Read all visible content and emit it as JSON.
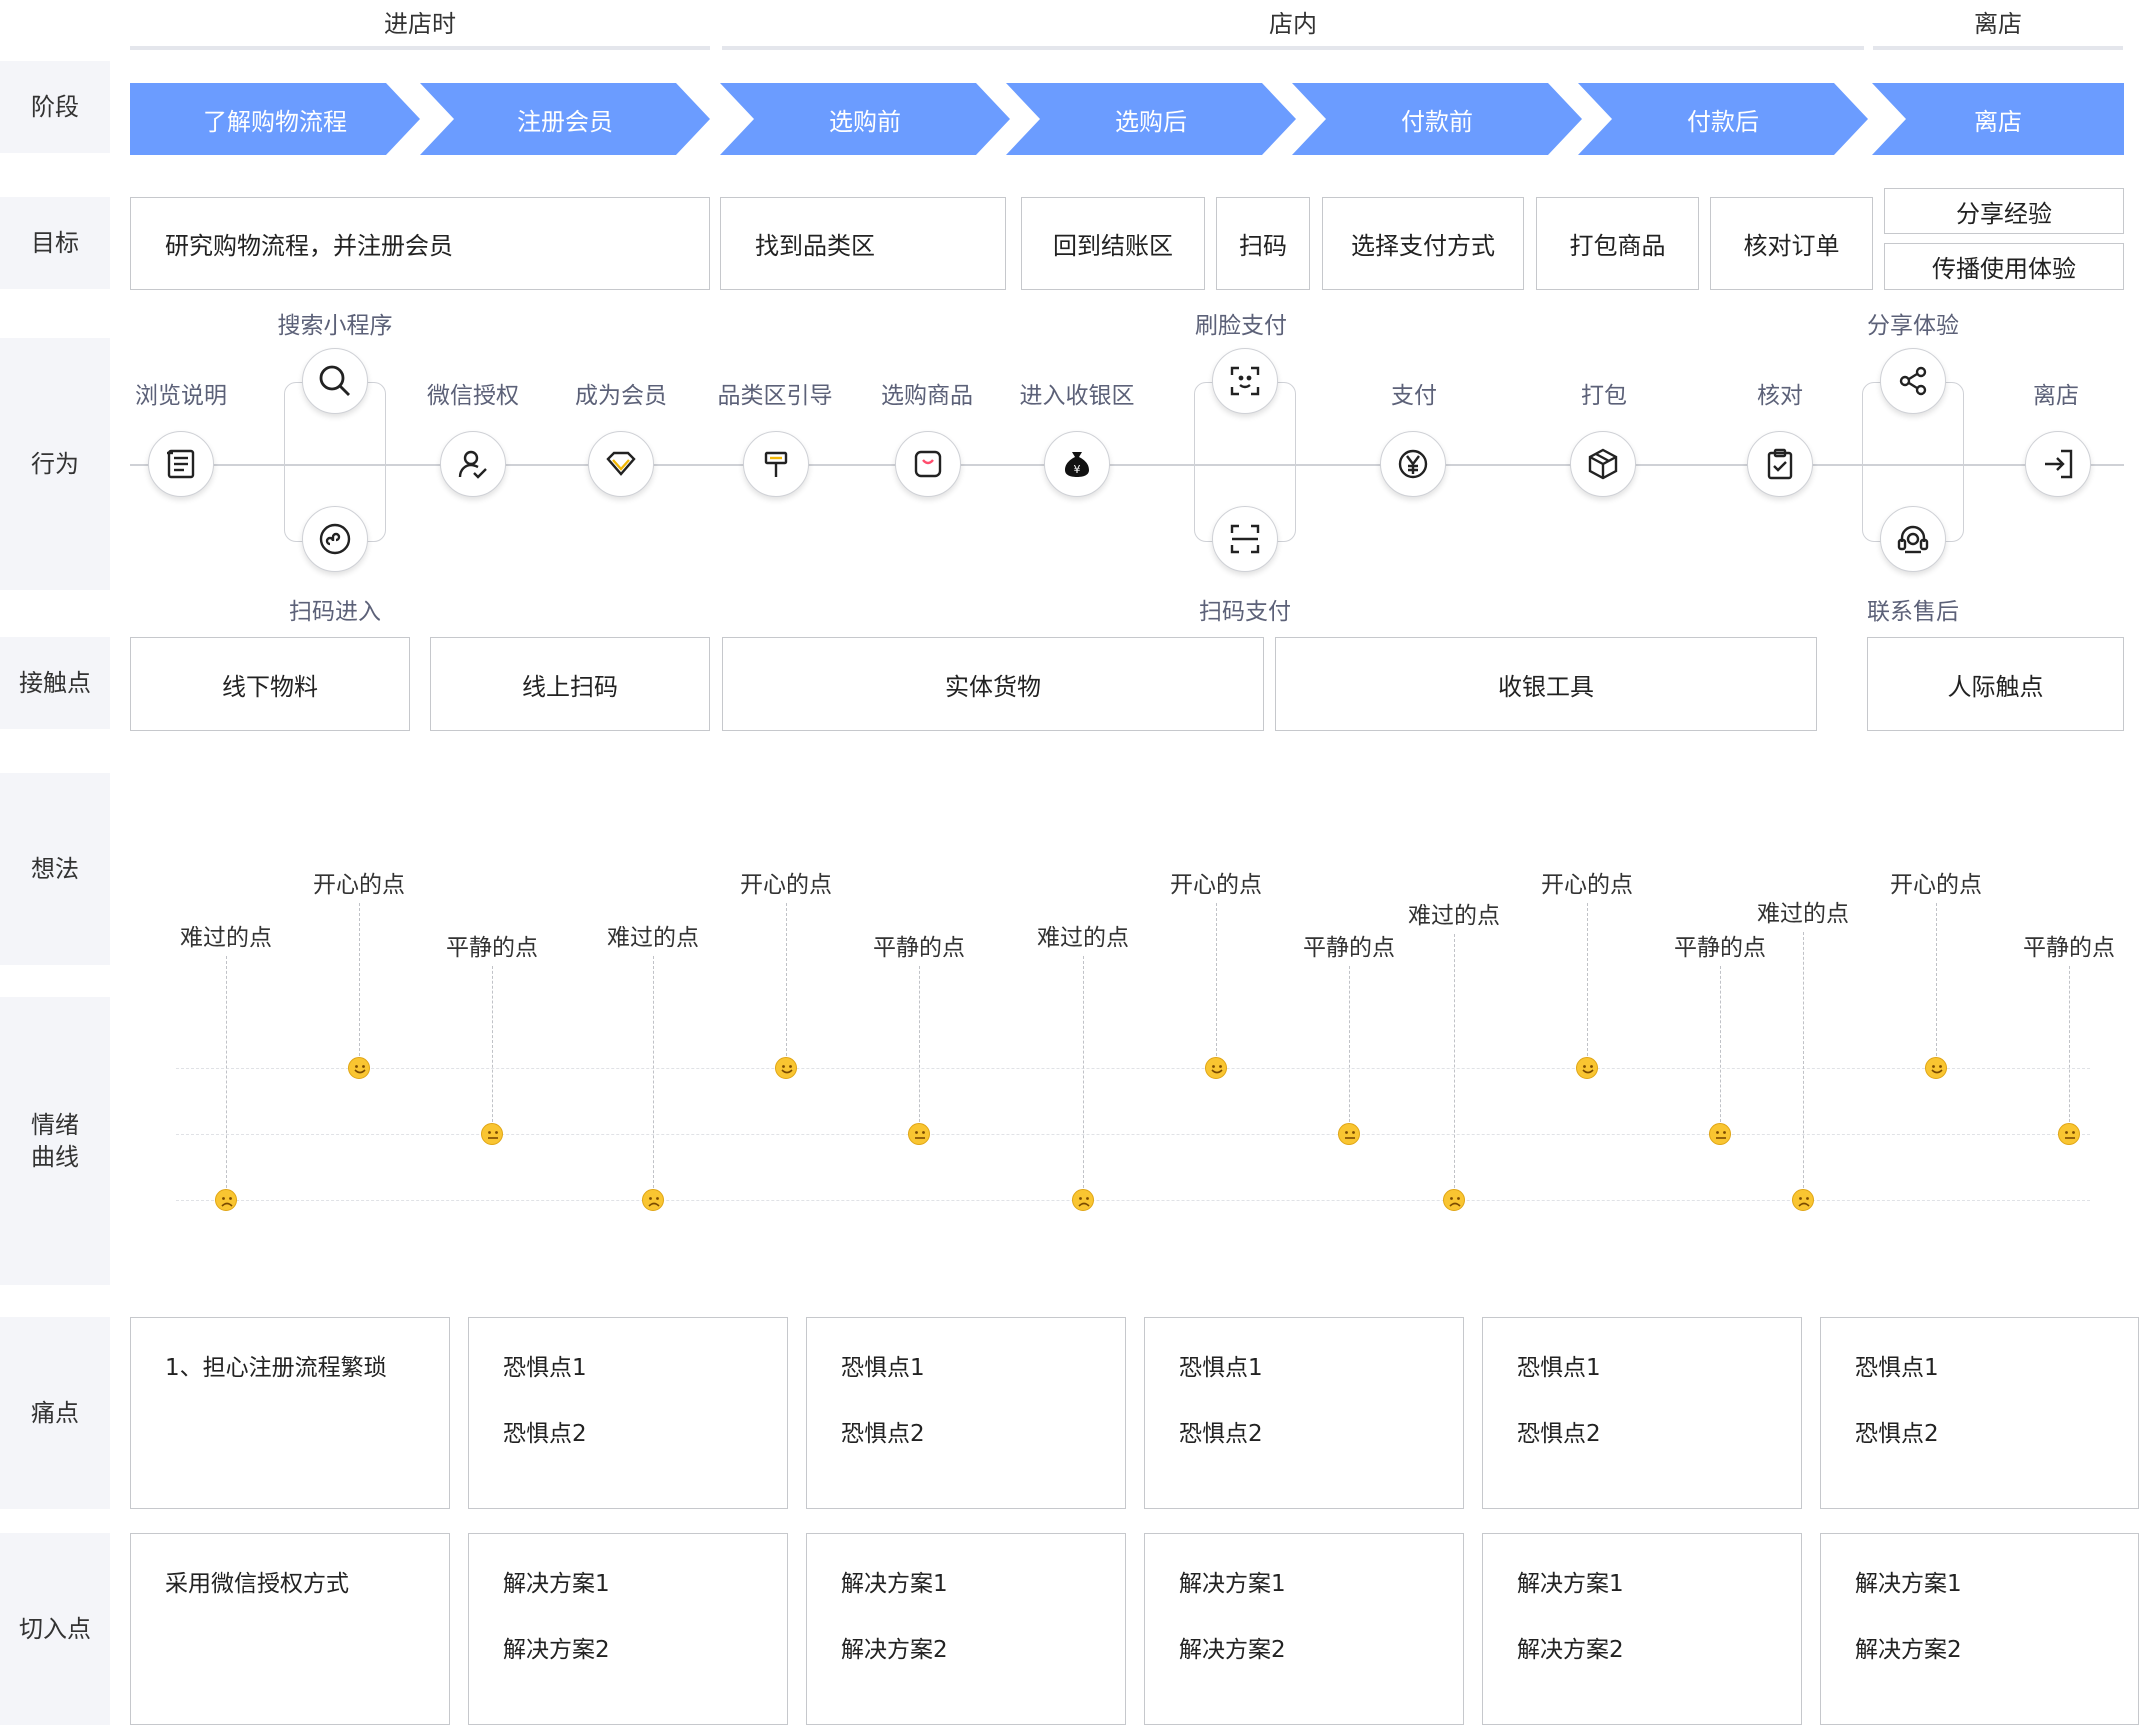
{
  "groups": [
    {
      "label": "进店时"
    },
    {
      "label": "店内"
    },
    {
      "label": "离店"
    }
  ],
  "rows": {
    "stage": "阶段",
    "goal": "目标",
    "behavior": "行为",
    "touchpoint": "接触点",
    "thought": "想法",
    "emotion": "情绪曲线",
    "pain": "痛点",
    "entry": "切入点"
  },
  "stages": [
    "了解购物流程",
    "注册会员",
    "选购前",
    "选购后",
    "付款前",
    "付款后",
    "离店"
  ],
  "goals": [
    "研究购物流程，并注册会员",
    "找到品类区",
    "回到结账区",
    "扫码",
    "选择支付方式",
    "打包商品",
    "核对订单",
    "分享经验",
    "传播使用体验"
  ],
  "actions": {
    "browse": {
      "label": "浏览说明",
      "icon": "document-icon"
    },
    "search_mini": {
      "label": "搜索小程序",
      "icon": "search-icon"
    },
    "scan_enter": {
      "label": "扫码进入",
      "icon": "mini-program-icon"
    },
    "wechat_auth": {
      "label": "微信授权",
      "icon": "user-check-icon"
    },
    "member": {
      "label": "成为会员",
      "icon": "diamond-icon"
    },
    "guide": {
      "label": "品类区引导",
      "icon": "signpost-icon"
    },
    "select": {
      "label": "选购商品",
      "icon": "shopping-bag-icon"
    },
    "checkout_zone": {
      "label": "进入收银区",
      "icon": "money-bag-icon"
    },
    "face_pay": {
      "label": "刷脸支付",
      "icon": "face-scan-icon"
    },
    "scan_pay": {
      "label": "扫码支付",
      "icon": "scan-icon"
    },
    "pay": {
      "label": "支付",
      "icon": "yen-icon"
    },
    "pack": {
      "label": "打包",
      "icon": "box-icon"
    },
    "verify": {
      "label": "核对",
      "icon": "clipboard-check-icon"
    },
    "share": {
      "label": "分享体验",
      "icon": "share-icon"
    },
    "contact": {
      "label": "联系售后",
      "icon": "headset-icon"
    },
    "leave": {
      "label": "离店",
      "icon": "exit-icon"
    }
  },
  "touchpoints": [
    "线下物料",
    "线上扫码",
    "实体货物",
    "收银工具",
    "人际触点"
  ],
  "thoughts": {
    "sad": "难过的点",
    "happy": "开心的点",
    "calm": "平静的点"
  },
  "emotion_levels": {
    "happy": 2,
    "calm": 1,
    "sad": 0
  },
  "pains": [
    {
      "lines": [
        "1、担心注册流程繁琐"
      ]
    },
    {
      "lines": [
        "恐惧点1",
        "恐惧点2"
      ]
    },
    {
      "lines": [
        "恐惧点1",
        "恐惧点2"
      ]
    },
    {
      "lines": [
        "恐惧点1",
        "恐惧点2"
      ]
    },
    {
      "lines": [
        "恐惧点1",
        "恐惧点2"
      ]
    },
    {
      "lines": [
        "恐惧点1",
        "恐惧点2"
      ]
    }
  ],
  "entries": [
    {
      "lines": [
        "采用微信授权方式"
      ]
    },
    {
      "lines": [
        "解决方案1",
        "解决方案2"
      ]
    },
    {
      "lines": [
        "解决方案1",
        "解决方案2"
      ]
    },
    {
      "lines": [
        "解决方案1",
        "解决方案2"
      ]
    },
    {
      "lines": [
        "解决方案1",
        "解决方案2"
      ]
    },
    {
      "lines": [
        "解决方案1",
        "解决方案2"
      ]
    }
  ],
  "colors": {
    "stage_fill": "#6b9cff",
    "label_bg": "#f4f5f9",
    "action_text": "#5c6178",
    "emoji": "#f9c531"
  }
}
